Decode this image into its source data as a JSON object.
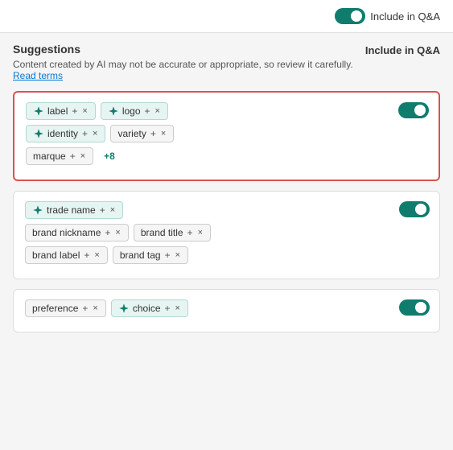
{
  "topBar": {
    "toggleLabel": "Include in Q&A",
    "toggleOn": true
  },
  "suggestions": {
    "title": "Suggestions",
    "description": "Content created by AI may not be accurate or appropriate, so review it carefully.",
    "readTermsLabel": "Read terms",
    "columnHeader": "Include in Q&A"
  },
  "cards": [
    {
      "id": "card1",
      "selected": true,
      "toggleOn": true,
      "rows": [
        [
          {
            "text": "label",
            "ai": true,
            "teal": true
          },
          {
            "text": "logo",
            "ai": true,
            "teal": true
          }
        ],
        [
          {
            "text": "identity",
            "ai": true,
            "teal": true
          },
          {
            "text": "variety",
            "ai": false,
            "teal": false
          }
        ],
        [
          {
            "text": "marque",
            "ai": false,
            "teal": false
          }
        ]
      ],
      "moreBadge": "+8"
    },
    {
      "id": "card2",
      "selected": false,
      "toggleOn": true,
      "rows": [
        [
          {
            "text": "trade name",
            "ai": true,
            "teal": true
          }
        ],
        [
          {
            "text": "brand nickname",
            "ai": false,
            "teal": false
          },
          {
            "text": "brand title",
            "ai": false,
            "teal": false
          }
        ],
        [
          {
            "text": "brand label",
            "ai": false,
            "teal": false
          },
          {
            "text": "brand tag",
            "ai": false,
            "teal": false
          }
        ]
      ],
      "moreBadge": null
    },
    {
      "id": "card3",
      "selected": false,
      "toggleOn": true,
      "rows": [
        [
          {
            "text": "preference",
            "ai": false,
            "teal": false
          },
          {
            "text": "choice",
            "ai": true,
            "teal": true
          }
        ]
      ],
      "moreBadge": null
    }
  ]
}
